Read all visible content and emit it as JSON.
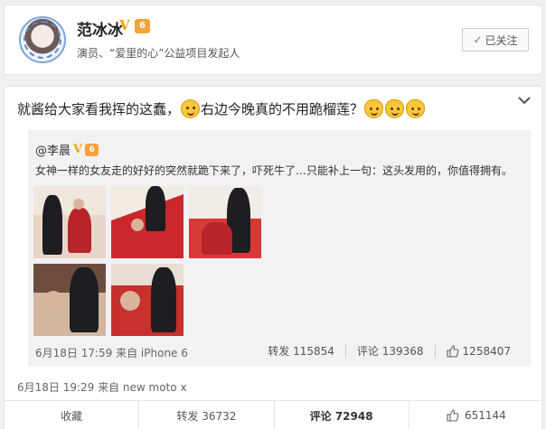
{
  "profile": {
    "name": "范冰冰",
    "verified_mark": "V",
    "vip_mark": "6",
    "bio": "演员、“爱里的心”公益项目发起人",
    "follow_label": "已关注",
    "follow_check": "✓"
  },
  "post": {
    "text_before": "就酱给大家看我挥的这蠢，",
    "text_after": "右边今晚真的不用跪榴莲？",
    "meta": "6月18日 19:29 来自 new moto x",
    "actions": {
      "favorite": "收藏",
      "repost": "转发 36732",
      "comment": "评论 72948",
      "like": "651144"
    }
  },
  "repost": {
    "author": "@李晨",
    "verified_mark": "V",
    "vip_mark": "6",
    "text": "女神一样的女友走的好好的突然就跪下来了，吓死牛了…只能补上一句：这头发用的，你值得拥有。",
    "meta": "6月18日 17:59 来自 iPhone 6",
    "repost_count": "转发 115854",
    "comment_count": "评论 139368",
    "like_count": "1258407"
  },
  "icons": [
    "chevron-down-icon",
    "check-icon",
    "thumbs-up-icon",
    "emoji-icon",
    "cat-emoji-icon"
  ]
}
